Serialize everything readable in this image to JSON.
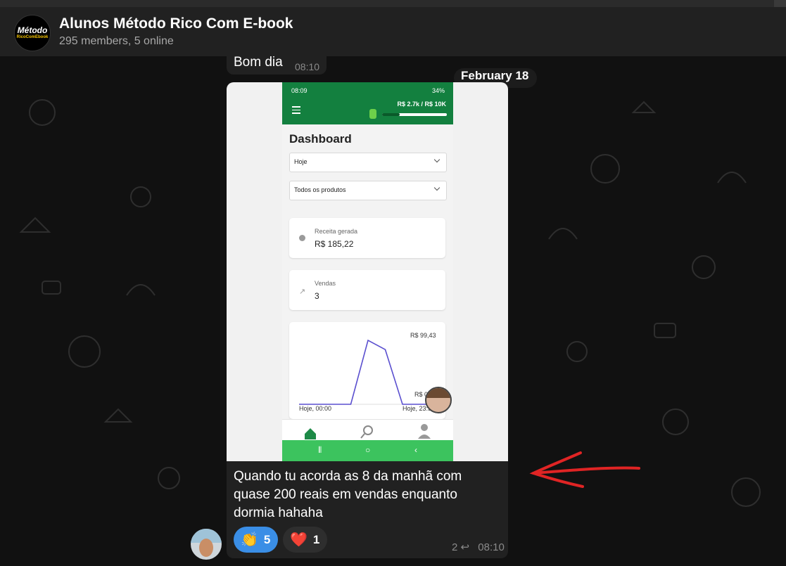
{
  "header": {
    "logo_line1": "Método",
    "logo_line2": "RicoComEbook",
    "title": "Alunos Método Rico Com E-book",
    "subtitle": "295 members, 5 online"
  },
  "previous_message": {
    "text": "Bom dia",
    "time": "08:10"
  },
  "date_separator": "February 18",
  "message": {
    "screenshot": {
      "status_time": "08:09",
      "status_icons": "34%",
      "goal": "R$ 2.7k / R$ 10K",
      "goal_progress": 0.27,
      "page_title": "Dashboard",
      "period_select": "Hoje",
      "product_select": "Todos os produtos",
      "revenue_label": "Receita gerada",
      "revenue_value": "R$ 185,22",
      "sales_label": "Vendas",
      "sales_value": "3",
      "chart_max_label": "R$ 99,43",
      "chart_min_label": "R$ 0",
      "chart_x_start": "Hoje, 00:00",
      "chart_x_end": "Hoje, 23:5"
    },
    "caption": "Quando tu acorda as 8 da manhã com quase 200 reais em vendas enquanto dormia hahaha",
    "reactions": [
      {
        "emoji": "👏",
        "count": "5"
      },
      {
        "emoji": "❤️",
        "count": "1"
      }
    ],
    "replies": "2",
    "time": "08:10"
  },
  "chart_data": {
    "type": "line",
    "title": "",
    "xlabel": "",
    "ylabel": "",
    "x": [
      "Hoje, 00:00",
      "",
      "",
      "",
      "",
      "",
      "",
      "",
      "Hoje, 23:5"
    ],
    "series": [
      {
        "values": [
          0,
          0,
          0,
          0,
          99.43,
          85,
          0,
          0,
          0
        ]
      }
    ],
    "ylim": [
      0,
      99.43
    ]
  },
  "colors": {
    "app_green": "#13803f",
    "nav_green": "#3cc35e",
    "reaction_blue": "#3a8ee6",
    "arrow_red": "#e02424",
    "chart_line": "#5a4fcf"
  }
}
